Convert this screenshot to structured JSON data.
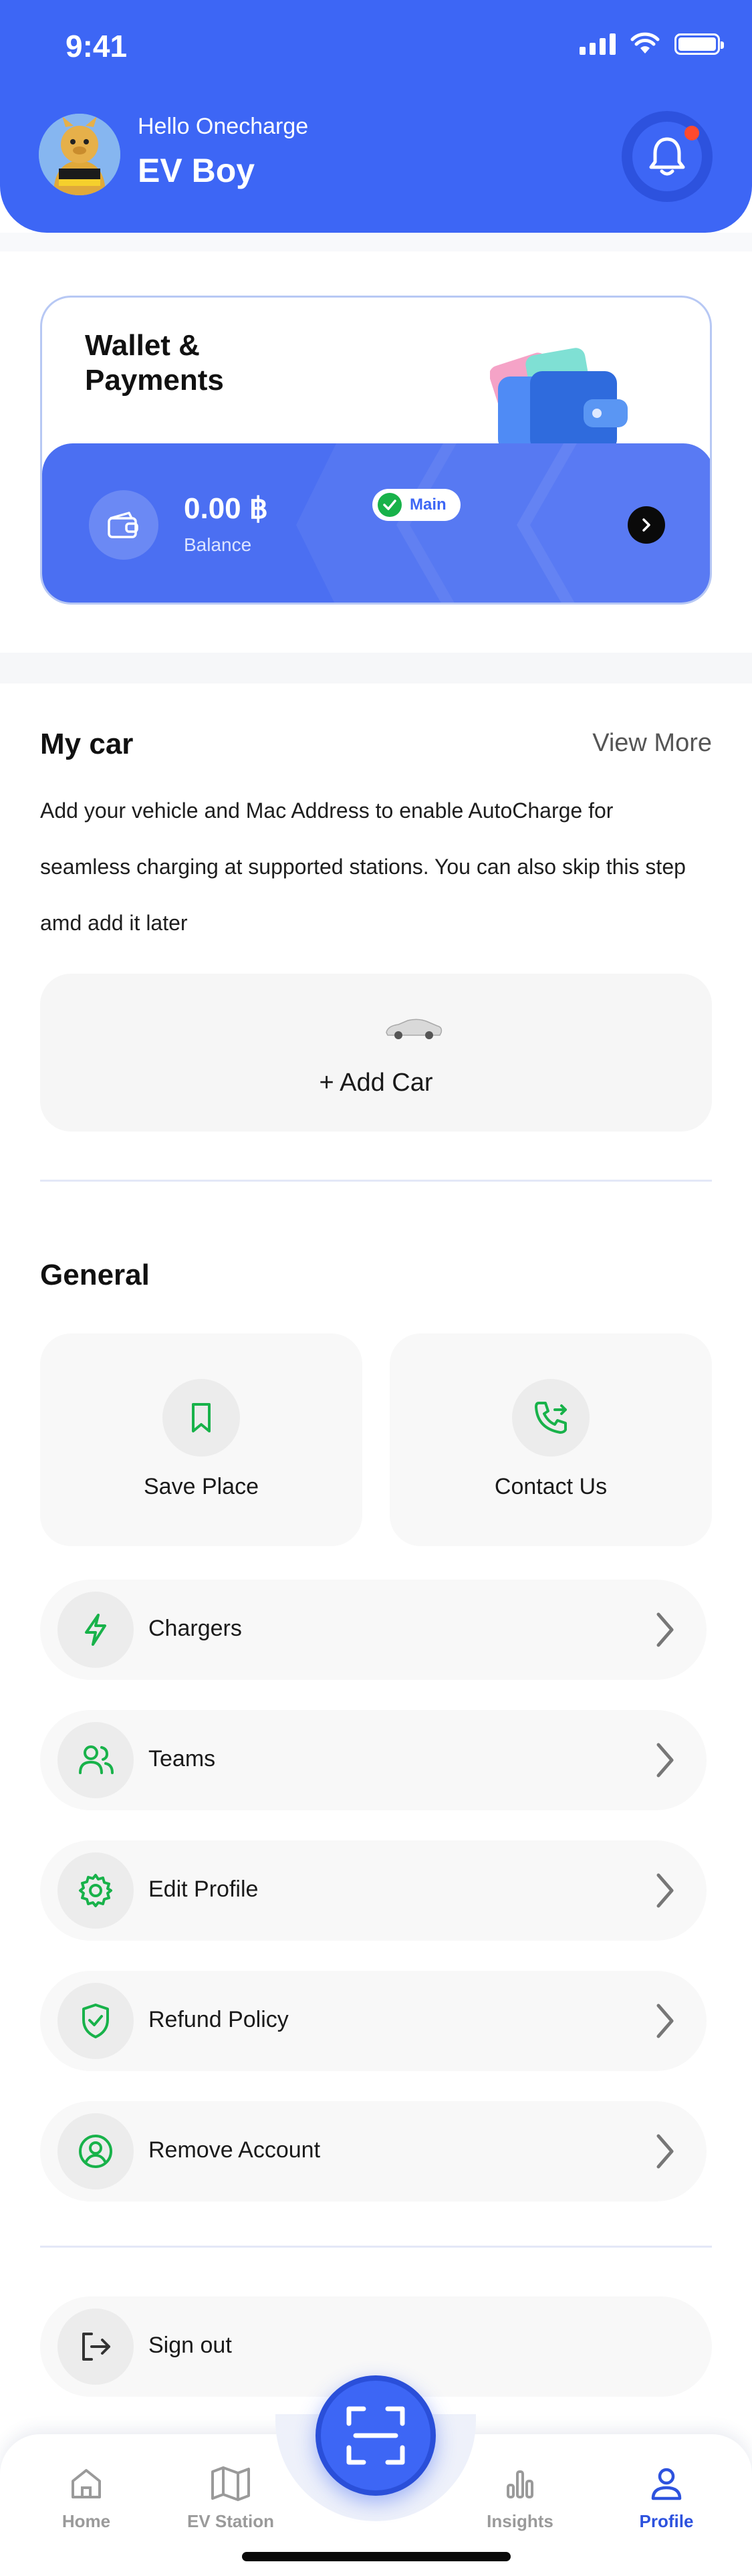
{
  "status_bar": {
    "time": "9:41"
  },
  "header": {
    "greeting": "Hello Onecharge",
    "user_name": "EV Boy"
  },
  "wallet": {
    "title": "Wallet & Payments",
    "amount": "0.00 ฿",
    "balance_label": "Balance",
    "badge": "Main"
  },
  "my_car": {
    "title": "My car",
    "view_more": "View More",
    "description": "Add your vehicle and Mac Address to enable AutoCharge for seamless charging at supported stations. You can also skip this step amd add it later",
    "add_car_label": "+ Add Car"
  },
  "general": {
    "title": "General",
    "tiles": [
      {
        "label": "Save Place",
        "icon": "bookmark-icon"
      },
      {
        "label": "Contact Us",
        "icon": "phone-forward-icon"
      }
    ],
    "items": [
      {
        "label": "Chargers",
        "icon": "lightning-icon"
      },
      {
        "label": "Teams",
        "icon": "users-icon"
      },
      {
        "label": "Edit Profile",
        "icon": "gear-icon"
      },
      {
        "label": "Refund Policy",
        "icon": "shield-check-icon"
      },
      {
        "label": "Remove Account",
        "icon": "user-circle-icon"
      }
    ],
    "sign_out": "Sign out"
  },
  "tabbar": {
    "items": [
      {
        "label": "Home",
        "icon": "home-icon"
      },
      {
        "label": "EV Station",
        "icon": "map-icon"
      },
      {
        "label": "Insights",
        "icon": "bar-chart-icon"
      },
      {
        "label": "Profile",
        "icon": "profile-icon"
      }
    ],
    "active": "Profile"
  },
  "colors": {
    "primary": "#3d66f5",
    "accent_green": "#18b24a",
    "notification": "#ff4a2e"
  }
}
